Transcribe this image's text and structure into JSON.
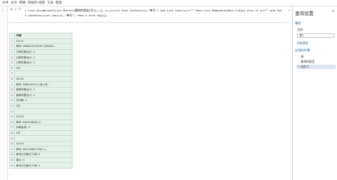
{
  "menu": {
    "file": "文件",
    "home": "主页",
    "transform": "转换",
    "add_column": "添加列",
    "view": "视图",
    "tools": "工具",
    "help": "帮助"
  },
  "formula": {
    "cancel_glyph": "✕",
    "commit_glyph": "✓",
    "fx": "fx",
    "text": "= List.Accumulate(List.Buffer(删除的错误[列1]),{},(x,y)=>if Text.Contains(y,\"单号\") and List.Last(x)<>\"\" then List.RemoveLastN(x,1)&{y} else if y<>\"\" and Text.Contains(List.Last(x),\"单号\") then x else x&{y})",
    "expand_glyph": "⌄"
  },
  "grid": {
    "header": "列表",
    "rows": [
      "10:01",
      "单号: 680827435207 (36498...",
      "订单件数合计: 2",
      "订单件数合计: 2",
      "订单件数合计: 2",
      "1件",
      "",
      "10:02",
      "单号: 686920310 (多入件...",
      "首单件数合计: 2",
      "首单件数合计: 2",
      "已付款: 2",
      "1件",
      "",
      "10:03",
      "单号: 680326840 ()",
      "价格信息: 3",
      "1件",
      "",
      "10:04",
      "单号: 681709817983 1...",
      "单号已付款已下单: 2",
      "单价: 2",
      "单号已付款已下单: 2"
    ]
  },
  "pane": {
    "title": "查询设置",
    "close_glyph": "✕",
    "properties_header": "属性",
    "name_label": "名称",
    "name_value": "表2",
    "all_properties_link": "所有属性",
    "applied_steps_header": "应用的步骤",
    "steps": [
      "源",
      "更改的类型",
      "自定义"
    ]
  }
}
